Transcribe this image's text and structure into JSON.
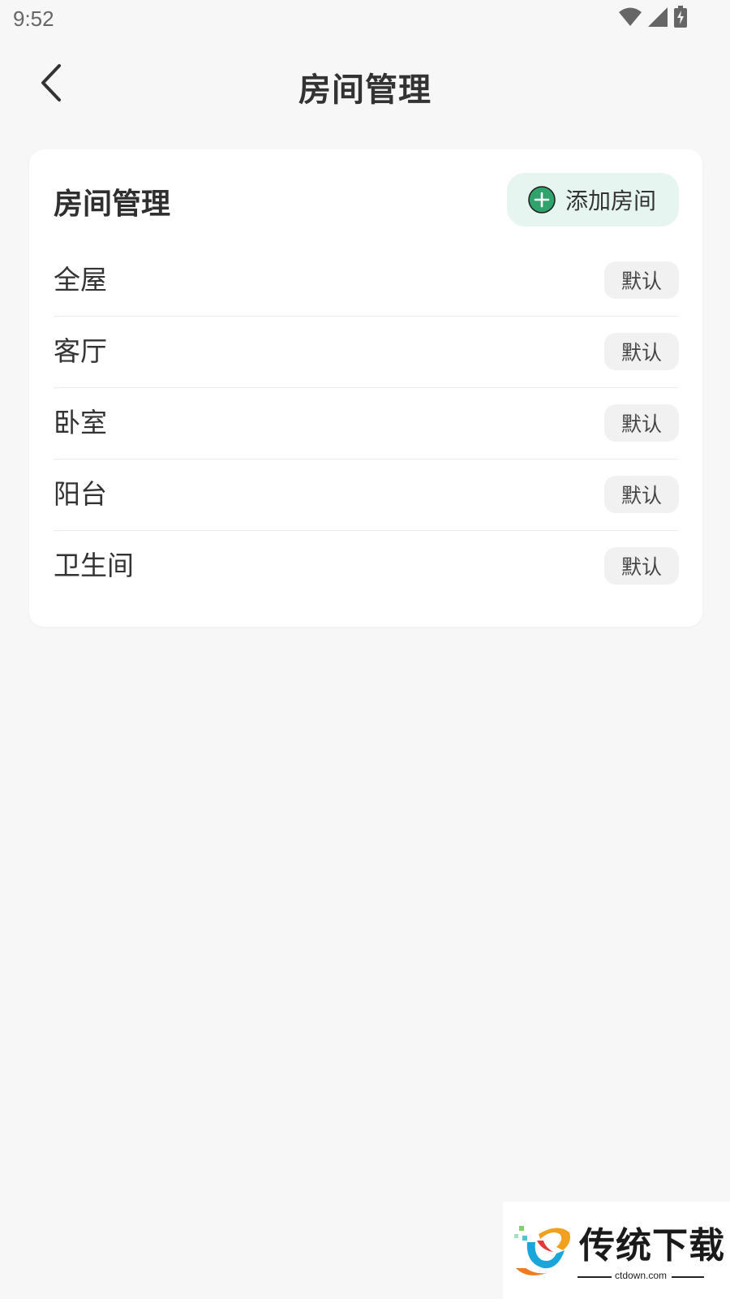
{
  "status_bar": {
    "time": "9:52",
    "icons": [
      "wifi-icon",
      "cellular-signal-icon",
      "battery-charging-icon"
    ]
  },
  "header": {
    "title": "房间管理",
    "back_icon": "chevron-left-icon"
  },
  "card": {
    "title": "房间管理",
    "add_button": {
      "label": "添加房间",
      "icon": "plus-circle-icon",
      "icon_color": "#2fa36b",
      "background": "#e6f5ef"
    },
    "rooms": [
      {
        "name": "全屋",
        "badge": "默认"
      },
      {
        "name": "客厅",
        "badge": "默认"
      },
      {
        "name": "卧室",
        "badge": "默认"
      },
      {
        "name": "阳台",
        "badge": "默认"
      },
      {
        "name": "卫生间",
        "badge": "默认"
      }
    ]
  },
  "watermark": {
    "brand": "传统下载",
    "domain": "ctdown.com"
  }
}
